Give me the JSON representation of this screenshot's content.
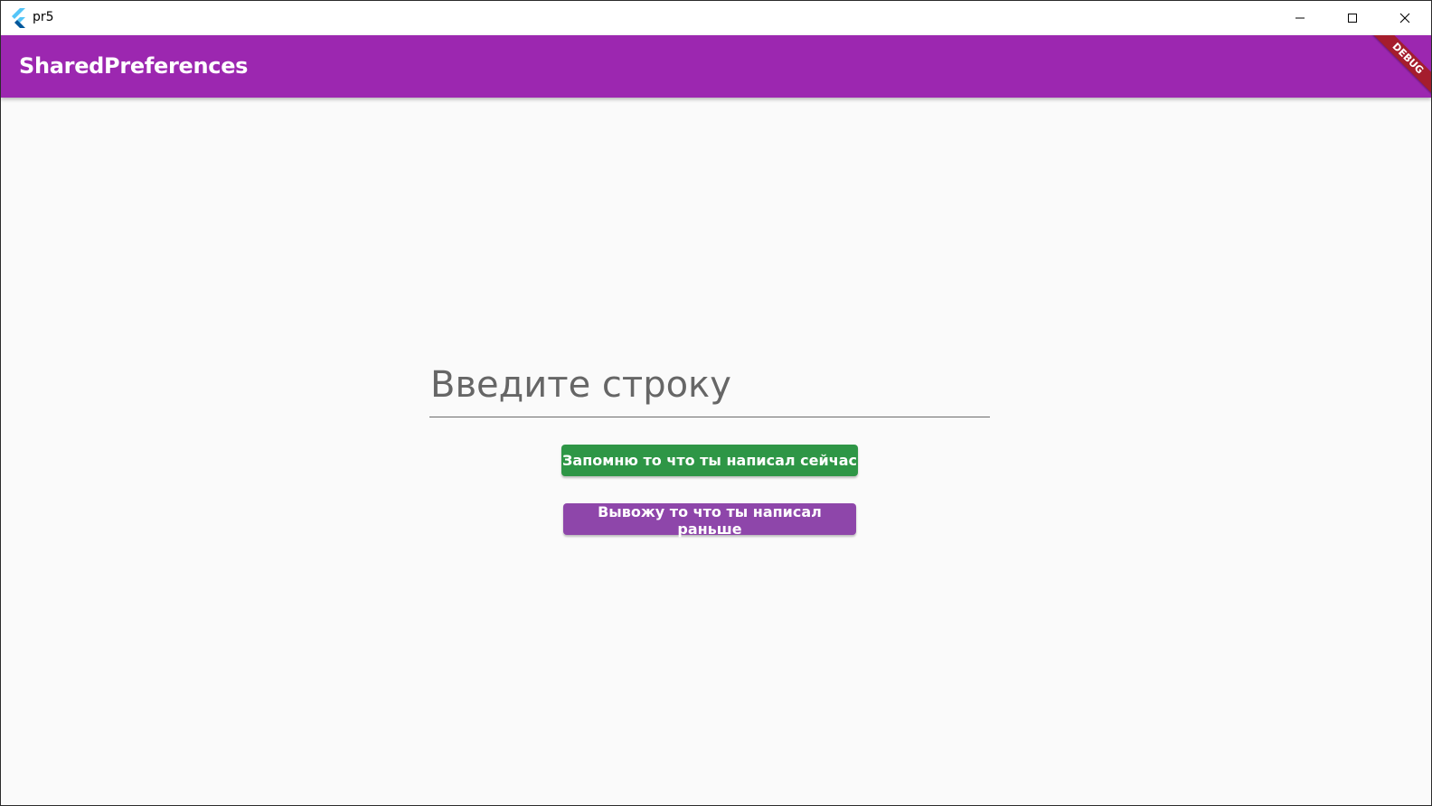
{
  "window": {
    "title": "pr5",
    "logo_icon": "flutter-logo-icon"
  },
  "appbar": {
    "title": "SharedPreferences",
    "background": "#9c27b0",
    "debug_banner": "DEBUG"
  },
  "form": {
    "input_placeholder": "Введите строку",
    "input_value": "",
    "save_button_label": "Запомню то что ты написал сейчас",
    "save_button_color": "#2e9646",
    "load_button_label": "Вывожу то что ты написал раньше",
    "load_button_color": "#8e46aa"
  }
}
